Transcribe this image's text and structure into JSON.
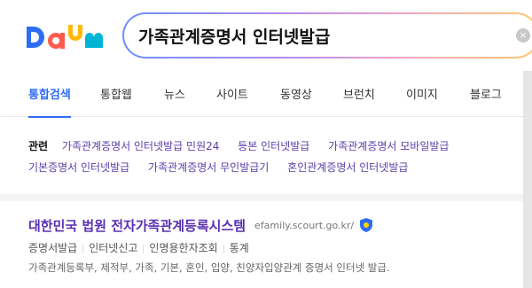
{
  "header": {
    "logo_text": "Daum",
    "search": {
      "value": "가족관계증명서 인터넷발급",
      "clear_icon": "×"
    },
    "colors": {
      "logo_d": "#2f6cf6",
      "logo_a": "#ff5b4f",
      "logo_u": "#ffb900",
      "logo_m": "#00b4d8"
    }
  },
  "tabs": [
    {
      "label": "통합검색",
      "active": true
    },
    {
      "label": "통합웹"
    },
    {
      "label": "뉴스"
    },
    {
      "label": "사이트"
    },
    {
      "label": "동영상"
    },
    {
      "label": "브런치"
    },
    {
      "label": "이미지"
    },
    {
      "label": "블로그"
    }
  ],
  "related": {
    "title": "관련",
    "row1": [
      "가족관계증명서 인터넷발급 민원24",
      "등본 인터넷발급",
      "가족관계증명서 모바일발급"
    ],
    "row2": [
      "기본증명서 인터넷발급",
      "가족관계증명서 무인발급기",
      "혼인관계증명서 인터넷발급"
    ]
  },
  "result": {
    "title": "대한민국 법원 전자가족관계등록시스템",
    "url": "efamily.scourt.go.kr/",
    "links": [
      "증명서발급",
      "인터넷신고",
      "인명용한자조회",
      "통계"
    ],
    "description": "가족관계등록부, 제적부, 가족, 기본, 혼인, 입양, 친양자입양관계 증명서 인터넷 발급."
  },
  "accent_colors": {
    "tab_active": "#2f6cf6",
    "link": "#5b3ea8",
    "result_title": "#5a2fb3"
  }
}
